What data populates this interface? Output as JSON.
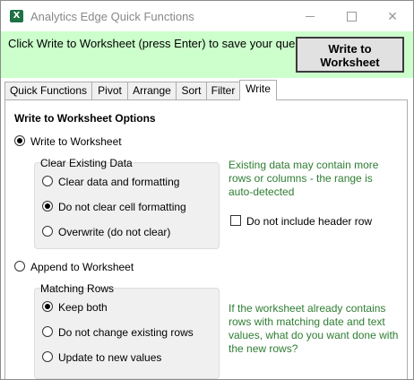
{
  "window": {
    "title": "Analytics Edge Quick Functions",
    "icon_letter": "X",
    "icon_name": "excel-icon",
    "minimize_icon": "minimize-icon",
    "maximize_icon": "maximize-icon",
    "close_glyph": "✕"
  },
  "infobar": {
    "message": "Click Write to Worksheet (press Enter) to save your query.",
    "button_line1": "Write to",
    "button_line2": "Worksheet",
    "background": "#ccffcc"
  },
  "tabs": [
    {
      "label": "Quick Functions",
      "active": false
    },
    {
      "label": "Pivot",
      "active": false
    },
    {
      "label": "Arrange",
      "active": false
    },
    {
      "label": "Sort",
      "active": false
    },
    {
      "label": "Filter",
      "active": false
    },
    {
      "label": "Write",
      "active": true
    }
  ],
  "options": {
    "heading": "Write to Worksheet Options",
    "write_radio": {
      "label": "Write to Worksheet",
      "checked": true
    },
    "clear_group": {
      "legend": "Clear Existing Data",
      "items": [
        {
          "label": "Clear data and formatting",
          "checked": false
        },
        {
          "label": "Do not clear cell formatting",
          "checked": true
        },
        {
          "label": "Overwrite (do not clear)",
          "checked": false
        }
      ]
    },
    "existing_note": "Existing data may contain more rows or columns - the range is auto-detected",
    "header_checkbox": {
      "label": "Do not include header row",
      "checked": false
    },
    "append_radio": {
      "label": "Append to Worksheet",
      "checked": false
    },
    "matching_group": {
      "legend": "Matching Rows",
      "items": [
        {
          "label": "Keep both",
          "checked": true
        },
        {
          "label": "Do not change existing rows",
          "checked": false
        },
        {
          "label": "Update to new values",
          "checked": false
        }
      ]
    },
    "matching_note": "If the worksheet already contains rows with matching date and text values, what do you want done with the new rows?",
    "note_color": "#2e7d32"
  }
}
